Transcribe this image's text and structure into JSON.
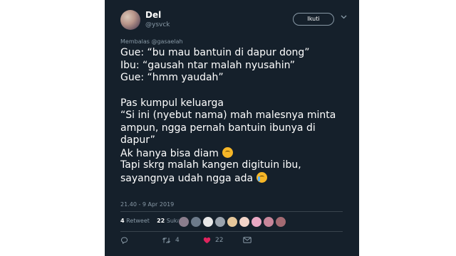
{
  "author": {
    "name": "Del",
    "handle": "@ysvck"
  },
  "follow_label": "Ikuti",
  "reply_to": {
    "prefix": "Membalas",
    "mention": "@gasaelah"
  },
  "tweet": {
    "lines": [
      "Gue: “bu mau bantuin di dapur dong”",
      "Ibu: “gausah ntar malah nyusahin”",
      "Gue: “hmm yaudah”",
      "Pas kumpul keluarga",
      "“Si ini (nyebut nama) mah malesnya minta",
      "ampun, ngga pernah bantuin ibunya di",
      "dapur”",
      "Ak hanya bisa diam",
      "Tapi skrg malah kangen digituin ibu,",
      "sayangnya udah ngga ada"
    ]
  },
  "timestamp": "21.40 - 9 Apr 2019",
  "stats": {
    "retweet_count": "4",
    "retweet_label": "Retweet",
    "like_count": "22",
    "like_label": "Suka"
  },
  "actions": {
    "retweet_count": "4",
    "like_count": "22"
  },
  "colors": {
    "background": "#15202b",
    "secondary_text": "#8899a6",
    "like_accent": "#e0245e"
  },
  "icons": [
    "reply-icon",
    "retweet-icon",
    "heart-icon",
    "message-icon",
    "upside-down-face-emoji",
    "crying-face-emoji",
    "chevron-down-icon"
  ]
}
